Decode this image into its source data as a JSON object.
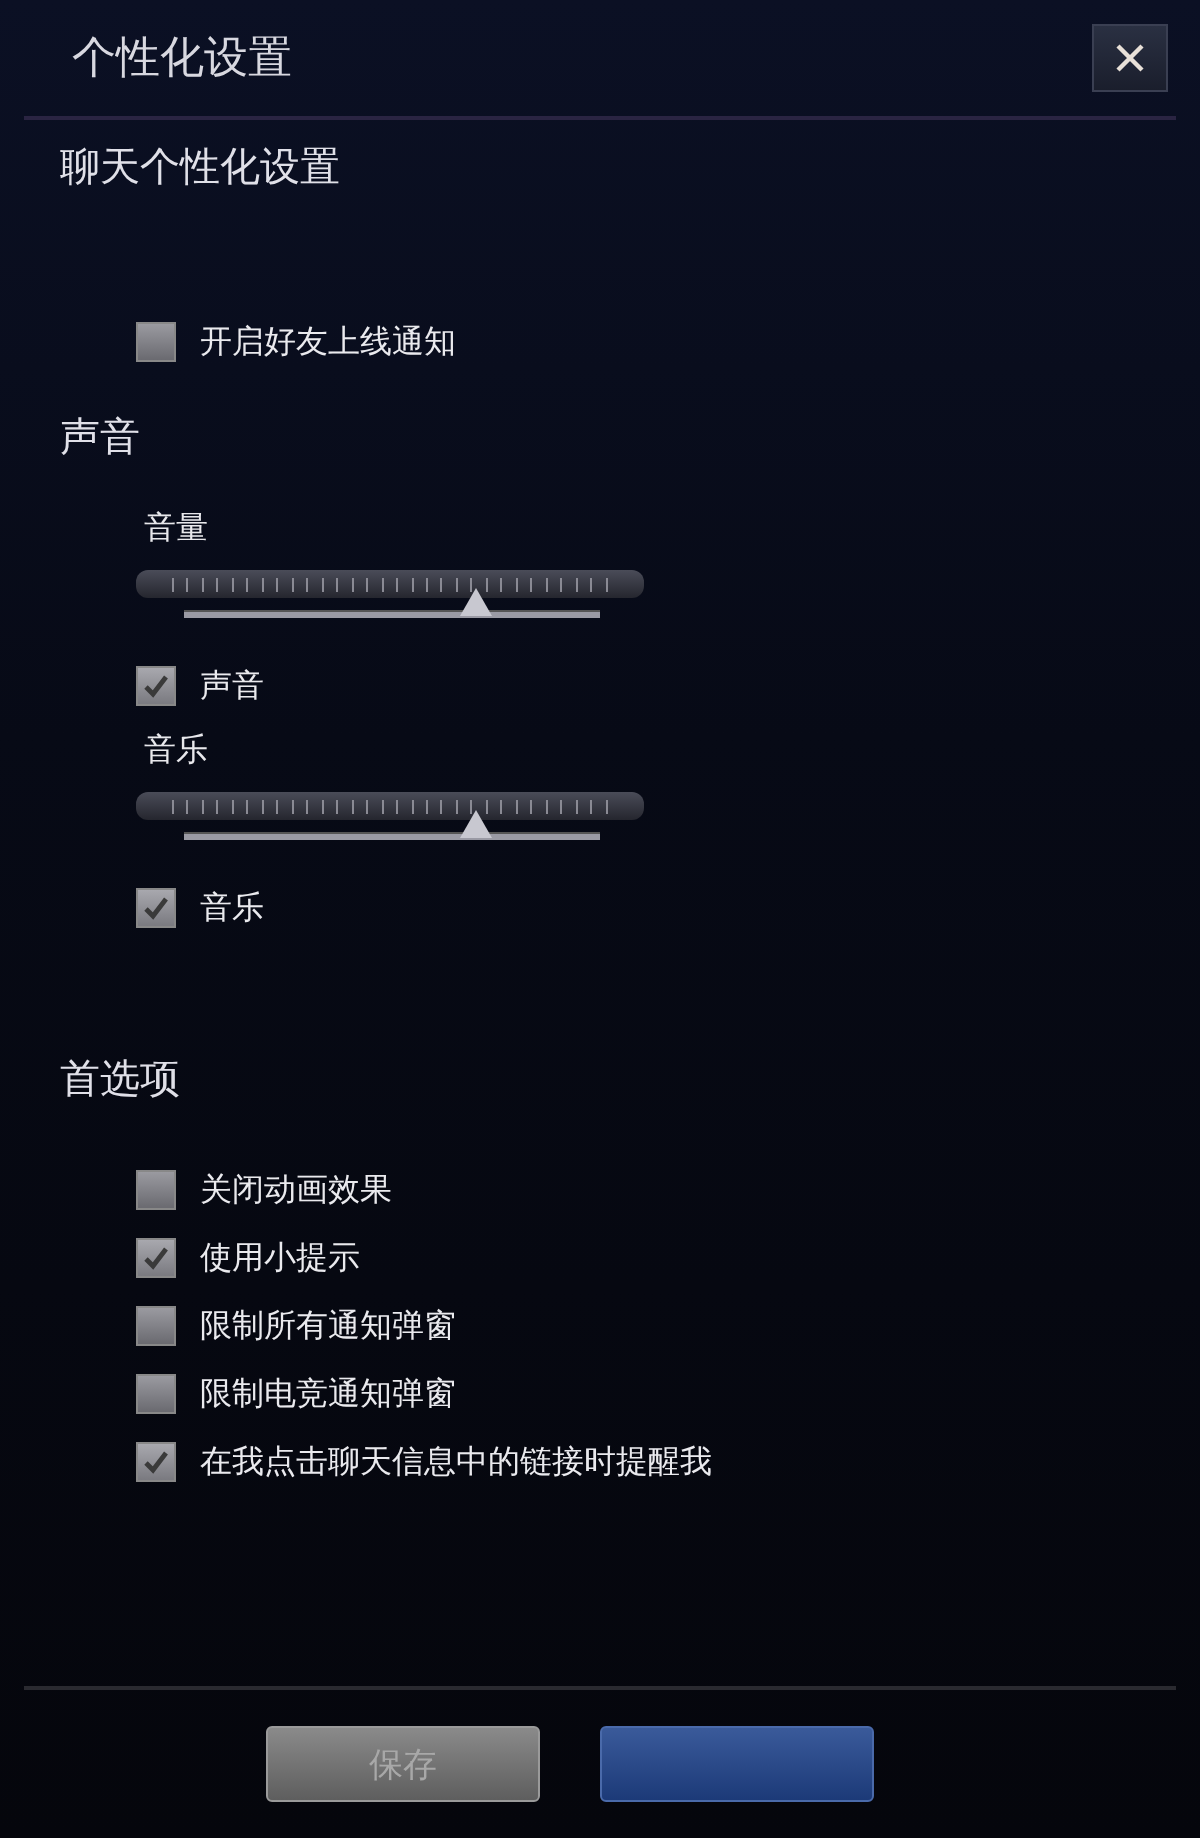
{
  "window": {
    "title": "个性化设置"
  },
  "sections": [
    {
      "title": "聊天个性化设置",
      "items": [
        {
          "kind": "checkbox",
          "label": "开启好友上线通知",
          "checked": false
        }
      ]
    },
    {
      "title": "声音",
      "items": [
        {
          "kind": "slider",
          "label": "音量",
          "level": 0.7
        },
        {
          "kind": "checkbox",
          "label": "声音",
          "checked": true
        },
        {
          "kind": "slider",
          "label": "音乐",
          "level": 0.7
        },
        {
          "kind": "checkbox",
          "label": "音乐",
          "checked": true
        }
      ]
    },
    {
      "title": "首选项",
      "items": [
        {
          "kind": "checkbox",
          "label": "关闭动画效果",
          "checked": false
        },
        {
          "kind": "checkbox",
          "label": "使用小提示",
          "checked": true
        },
        {
          "kind": "checkbox",
          "label": "限制所有通知弹窗",
          "checked": false
        },
        {
          "kind": "checkbox",
          "label": "限制电竞通知弹窗",
          "checked": false
        },
        {
          "kind": "checkbox",
          "label": "在我点击聊天信息中的链接时提醒我",
          "checked": true
        }
      ]
    }
  ],
  "buttons": [
    {
      "kind": "secondary",
      "label": "保存",
      "disabled": true
    },
    {
      "kind": "primary",
      "disabled": false
    }
  ]
}
